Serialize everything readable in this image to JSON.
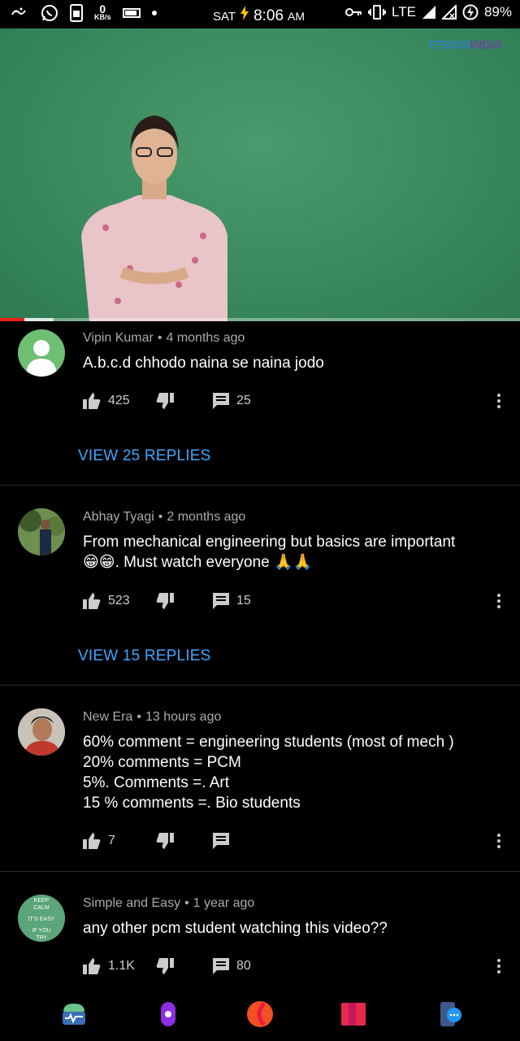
{
  "status_bar": {
    "net_speed_value": "0",
    "net_speed_unit": "KB/s",
    "day": "SAT",
    "time": "8:06",
    "ampm": "AM",
    "network": "LTE",
    "battery": "89%"
  },
  "video": {
    "watermark_part1": "ETOOS",
    "watermark_part2": "INDIA",
    "progress_fraction": 0.047,
    "buffered_fraction": 0.103
  },
  "comments": [
    {
      "author": "Vipin Kumar",
      "time": "4 months ago",
      "text": "A.b.c.d chhodo naina se naina jodo",
      "likes": "425",
      "replies_count": "25",
      "view_replies": "VIEW 25 REPLIES"
    },
    {
      "author": "Abhay Tyagi",
      "time": "2 months ago",
      "text": "From mechanical engineering but basics are important\n😁😁.  Must watch everyone 🙏🙏",
      "likes": "523",
      "replies_count": "15",
      "view_replies": "VIEW 15 REPLIES"
    },
    {
      "author": "New Era",
      "time": "13 hours ago",
      "text": "60% comment = engineering students (most of mech )\n20% comments   =    PCM\n5%. Comments   =.  Art\n15 % comments  =.  Bio students",
      "likes": "7",
      "replies_count": ""
    },
    {
      "author": "Simple and Easy",
      "time": "1 year ago",
      "text": "any other pcm student watching this video??",
      "likes": "1.1K",
      "replies_count": "80",
      "avatar_text": [
        "KEEP",
        "CALM",
        "IT'S EASY",
        "IF YOU",
        "TRY"
      ]
    }
  ],
  "nav_icons": [
    "android-monitor-icon",
    "screen-recorder-icon",
    "orange-circle-app-icon",
    "cards-app-icon",
    "chat-phone-icon"
  ],
  "colors": {
    "link": "#3ea6ff",
    "progress": "#e62117",
    "meta": "#aaaaaa",
    "video_bg": "#3a8a5e"
  }
}
